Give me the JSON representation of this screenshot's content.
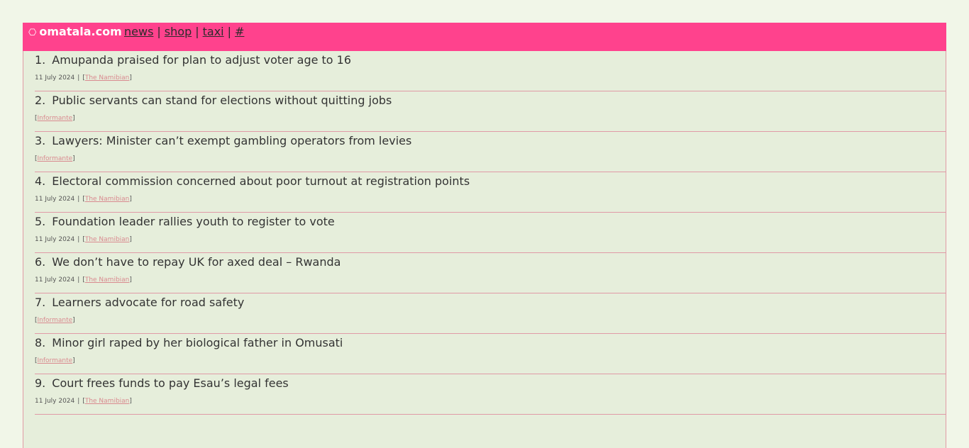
{
  "header": {
    "logo_icon": "⎔",
    "site_name": "omatala.com",
    "nav": [
      "news",
      "shop",
      "taxi",
      "#"
    ],
    "separator": "|"
  },
  "colors": {
    "header_bg": "#ff428d",
    "page_bg": "#f1f6e8",
    "list_bg": "#e6eedb",
    "divider": "#e09aa6"
  },
  "articles": [
    {
      "num": "1.",
      "title": "Amupanda praised for plan to adjust voter age to 16",
      "date": "11 July 2024",
      "source": "The Namibian"
    },
    {
      "num": "2.",
      "title": "Public servants can stand for elections without quitting jobs",
      "date": "",
      "source": "Informante"
    },
    {
      "num": "3.",
      "title": "Lawyers: Minister can’t exempt gambling operators from levies",
      "date": "",
      "source": "Informante"
    },
    {
      "num": "4.",
      "title": "Electoral commission concerned about poor turnout at registration points",
      "date": "11 July 2024",
      "source": "The Namibian"
    },
    {
      "num": "5.",
      "title": "Foundation leader rallies youth to register to vote",
      "date": "11 July 2024",
      "source": "The Namibian"
    },
    {
      "num": "6.",
      "title": "We don’t have to repay UK for axed deal – Rwanda",
      "date": "11 July 2024",
      "source": "The Namibian"
    },
    {
      "num": "7.",
      "title": "Learners advocate for road safety",
      "date": "",
      "source": "Informante"
    },
    {
      "num": "8.",
      "title": "Minor girl raped by her biological father in Omusati",
      "date": "",
      "source": "Informante"
    },
    {
      "num": "9.",
      "title": "Court frees funds to pay Esau’s legal fees",
      "date": "11 July 2024",
      "source": "The Namibian"
    }
  ]
}
